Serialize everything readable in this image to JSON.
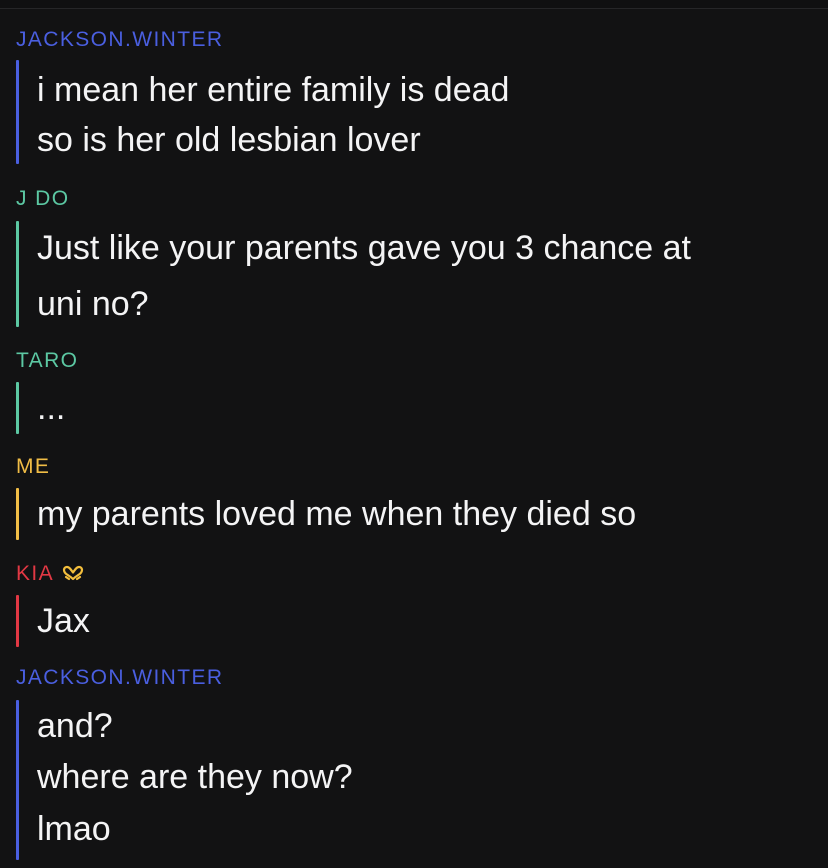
{
  "chat": {
    "messages": [
      {
        "author": "JACKSON.WINTER",
        "author_color": "#4a5fe0",
        "lines": [
          "i mean her entire family is dead",
          "so is her old lesbian lover"
        ]
      },
      {
        "author": "J DO",
        "author_color": "#5cc8a3",
        "lines": [
          "Just like your parents gave you 3 chance at",
          "uni no?"
        ]
      },
      {
        "author": "TARO",
        "author_color": "#5cc8a3",
        "lines": [
          "..."
        ]
      },
      {
        "author": "ME",
        "author_color": "#f1bd46",
        "lines": [
          "my parents loved me when they died so"
        ]
      },
      {
        "author": "KIA",
        "author_color": "#e23844",
        "author_icon": "heart-hands-emoji-icon",
        "lines": [
          "Jax"
        ]
      },
      {
        "author": "JACKSON.WINTER",
        "author_color": "#4a5fe0",
        "lines": [
          "and?",
          "where are they now?",
          "lmao"
        ]
      }
    ]
  }
}
